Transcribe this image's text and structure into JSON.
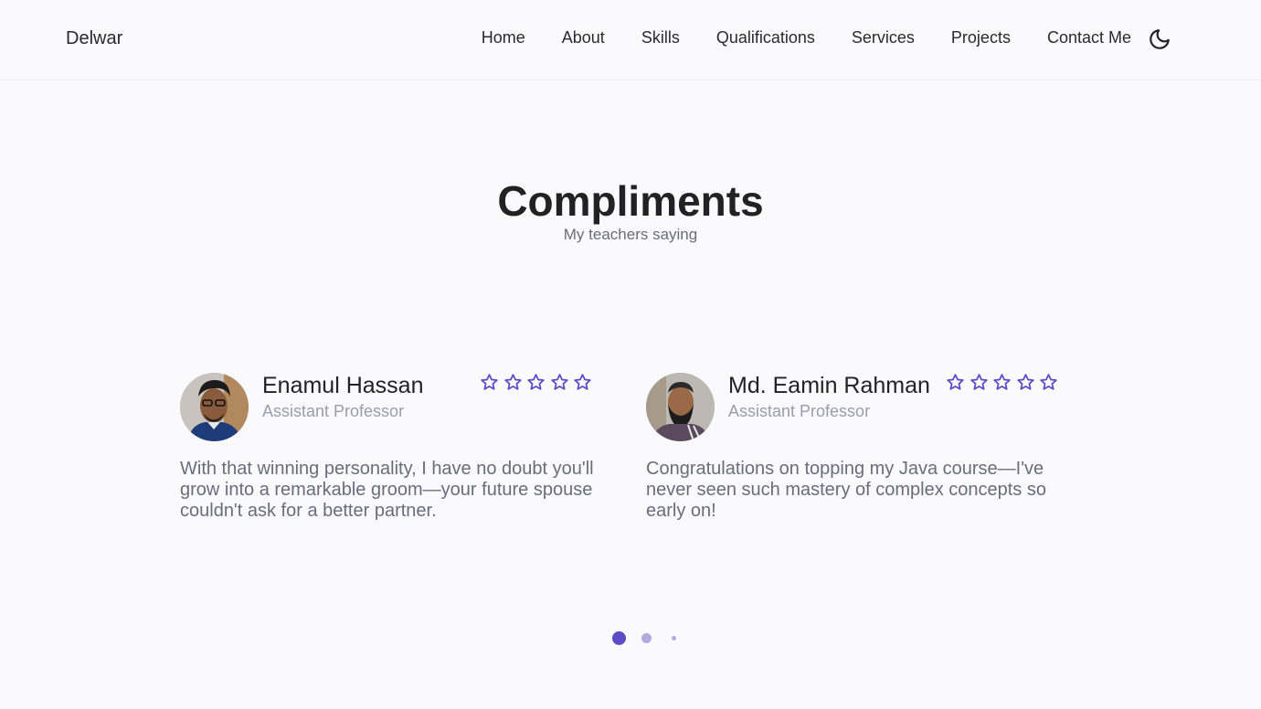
{
  "header": {
    "logo": "Delwar",
    "nav": [
      "Home",
      "About",
      "Skills",
      "Qualifications",
      "Services",
      "Projects",
      "Contact Me"
    ],
    "theme_icon": "moon-icon"
  },
  "section": {
    "title": "Compliments",
    "subtitle": "My teachers saying"
  },
  "testimonials": [
    {
      "name": "Enamul Hassan",
      "role": "Assistant Professor",
      "rating": 5,
      "quote": "With that winning personality, I have no doubt you'll grow into a remarkable groom—your future spouse couldn't ask for a better partner."
    },
    {
      "name": "Md. Eamin Rahman",
      "role": "Assistant Professor",
      "rating": 5,
      "quote": "Congratulations on topping my Java course—I've never seen such mastery of complex concepts so early on!"
    }
  ],
  "pagination": {
    "pages": 3,
    "active": 1
  },
  "colors": {
    "accent": "#5b4bc4",
    "accent_light": "#b3abe0",
    "text": "#222222",
    "muted": "#6b6b7b",
    "background": "#fafafd"
  }
}
